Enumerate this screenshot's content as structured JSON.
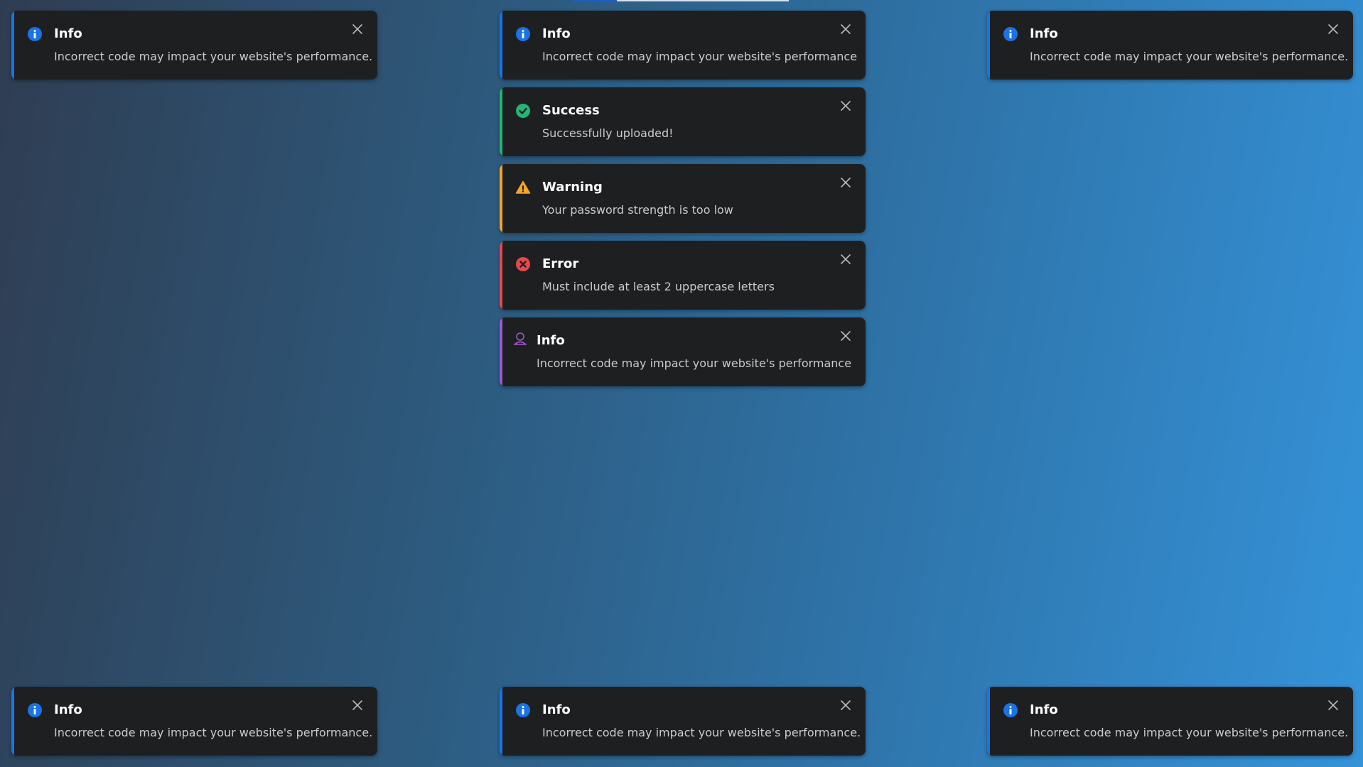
{
  "colors": {
    "info": "#1a73e8",
    "success": "#22b573",
    "warning": "#f5a524",
    "error": "#e5484d",
    "custom": "#9b59d0"
  },
  "toasts": [
    {
      "id": "top-left",
      "type": "info",
      "icon": "info-icon",
      "title": "Info",
      "message": "Incorrect code may impact your website's performance."
    },
    {
      "id": "top-center",
      "type": "info",
      "icon": "info-icon",
      "title": "Info",
      "message": "Incorrect code may impact your website's performance"
    },
    {
      "id": "top-right",
      "type": "info",
      "icon": "info-icon",
      "title": "Info",
      "message": "Incorrect code may impact your website's performance."
    },
    {
      "id": "center-success",
      "type": "success",
      "icon": "check-circle-icon",
      "title": "Success",
      "message": "Successfully uploaded!"
    },
    {
      "id": "center-warning",
      "type": "warning",
      "icon": "warning-triangle-icon",
      "title": "Warning",
      "message": "Your password strength is too low"
    },
    {
      "id": "center-error",
      "type": "error",
      "icon": "x-circle-icon",
      "title": "Error",
      "message": "Must include at least 2 uppercase letters"
    },
    {
      "id": "center-custom",
      "type": "custom",
      "icon": "user-badge-icon",
      "title": "Info",
      "message": "Incorrect code may impact your website's performance"
    },
    {
      "id": "bottom-left",
      "type": "info",
      "icon": "info-icon",
      "title": "Info",
      "message": "Incorrect code may impact your website's performance."
    },
    {
      "id": "bottom-center",
      "type": "info",
      "icon": "info-icon",
      "title": "Info",
      "message": "Incorrect code may impact your website's performance."
    },
    {
      "id": "bottom-right",
      "type": "info",
      "icon": "info-icon",
      "title": "Info",
      "message": "Incorrect code may impact your website's performance."
    }
  ],
  "close_icon": "close-icon"
}
